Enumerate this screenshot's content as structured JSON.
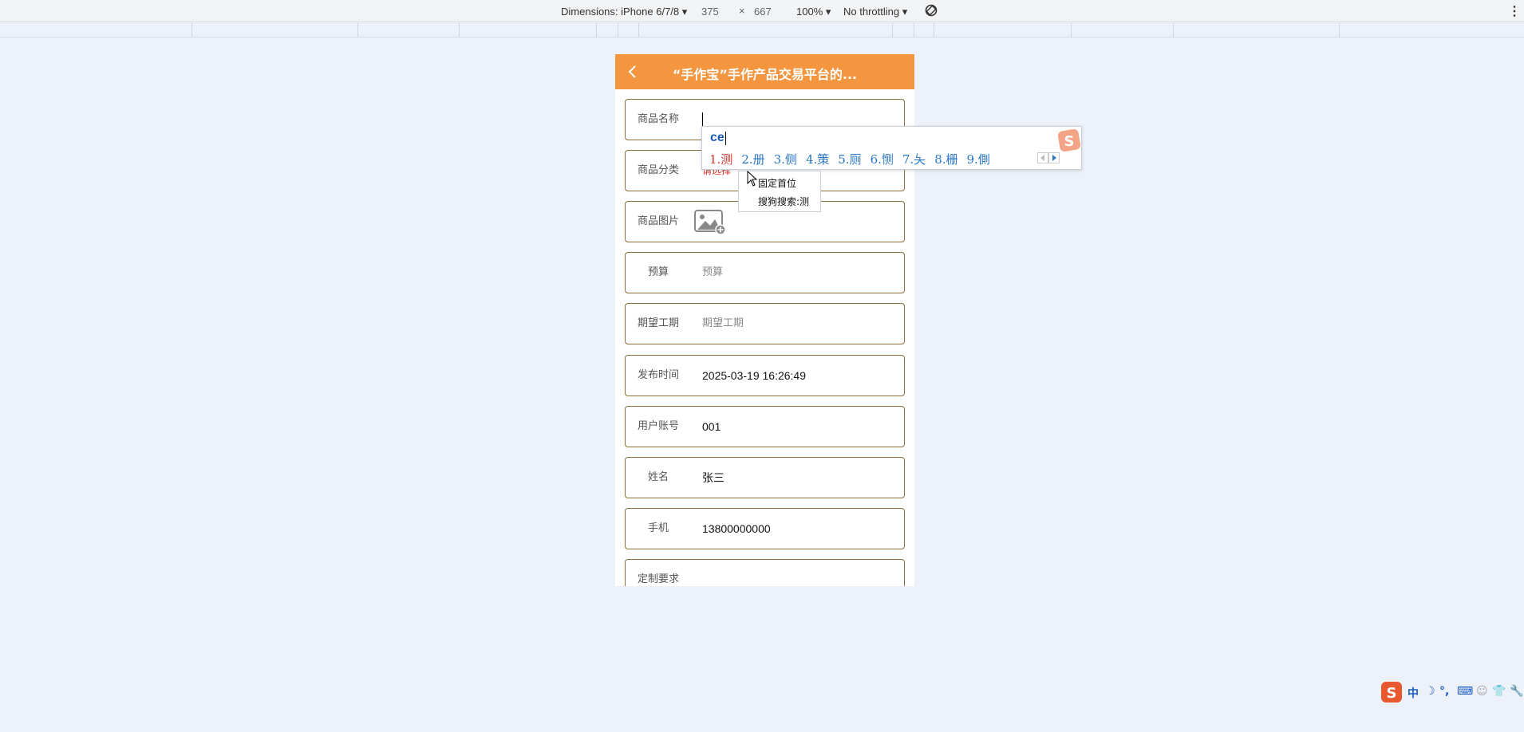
{
  "devtools": {
    "dimensions_label": "Dimensions: iPhone 6/7/8 ▾",
    "width": "375",
    "times": "×",
    "height": "667",
    "zoom": "100% ▾",
    "throttling": "No throttling ▾",
    "rotate_icon": "rotate-icon",
    "more_icon": "⋮"
  },
  "app": {
    "title": "“手作宝”手作产品交易平台的...",
    "header_color": "#f3963f",
    "back_icon": "chevron-left-icon"
  },
  "form": {
    "fields": [
      {
        "label": "商品名称",
        "value": ""
      },
      {
        "label": "商品分类",
        "value": "请选择"
      },
      {
        "label": "商品图片",
        "value": ""
      },
      {
        "label": "预算",
        "placeholder": "预算"
      },
      {
        "label": "期望工期",
        "placeholder": "期望工期"
      },
      {
        "label": "发布时间",
        "value": "2025-03-19 16:26:49"
      },
      {
        "label": "用户账号",
        "value": "001"
      },
      {
        "label": "姓名",
        "value": "张三"
      },
      {
        "label": "手机",
        "value": "13800000000"
      },
      {
        "label": "定制要求",
        "value": ""
      }
    ]
  },
  "ime": {
    "pinyin": "ce",
    "candidates": [
      "1.测",
      "2.册",
      "3.侧",
      "4.策",
      "5.厕",
      "6.恻",
      "7.夨",
      "8.栅",
      "9.側"
    ],
    "context_menu": [
      "固定首位",
      "搜狗搜索:测"
    ],
    "tray_items": [
      "中",
      "☽",
      "°,",
      "⌨",
      "👕",
      "🔧"
    ]
  }
}
